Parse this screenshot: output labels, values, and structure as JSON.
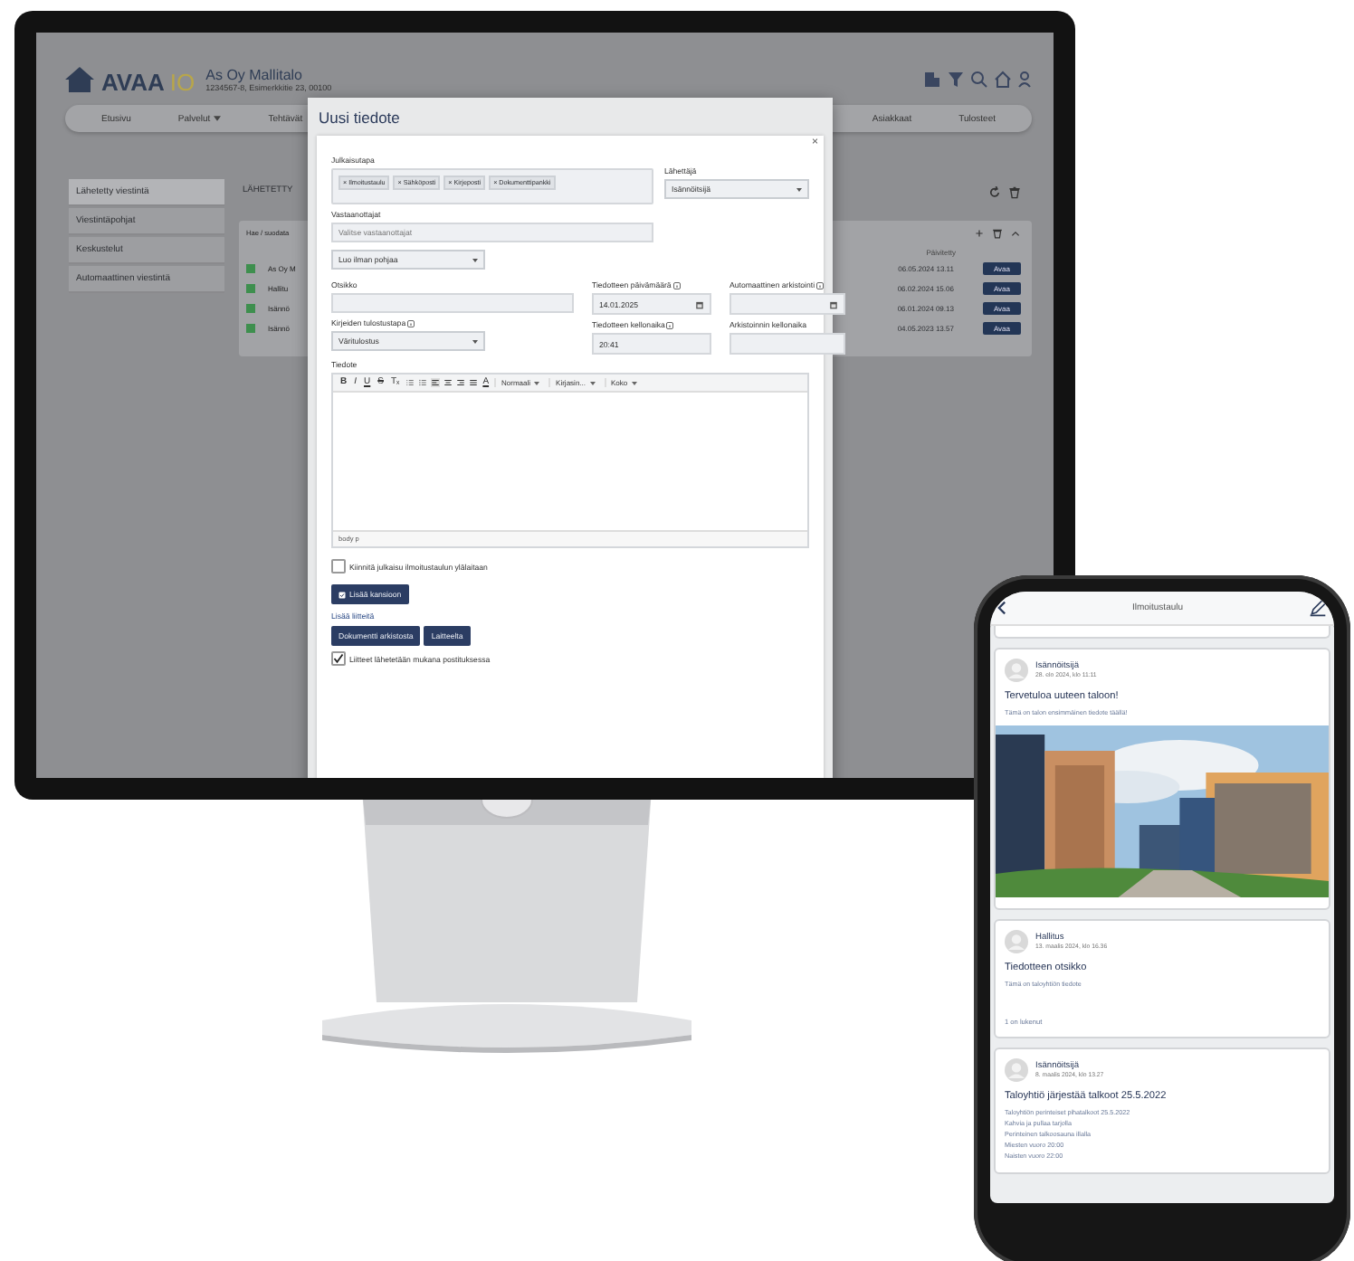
{
  "monitor": {
    "app": {
      "logo": {
        "text": "AVAA",
        "accent": "IO"
      },
      "company": "As Oy Mallitalo",
      "address": "1234567-8, Esimerkkitie 23, 00100",
      "nav": [
        {
          "label": "Etusivu",
          "dropdown": false
        },
        {
          "label": "Palvelut",
          "dropdown": true
        },
        {
          "label": "Tehtävät",
          "dropdown": false
        }
      ],
      "right_nav": [
        "Asiakkaat",
        "Tulosteet"
      ],
      "sidebar": [
        {
          "label": "Lähetetty viestintä",
          "selected": true
        },
        {
          "label": "Viestintäpohjat",
          "selected": false
        },
        {
          "label": "Keskustelut",
          "selected": false
        },
        {
          "label": "Automaattinen viestintä",
          "selected": false
        }
      ],
      "panel": {
        "title": "LÄHETETTY",
        "filter": "Hae / suodata",
        "column": "Päivitetty",
        "rows": [
          {
            "name": "As Oy M",
            "date": "06.05.2024 13.11",
            "action": "Avaa"
          },
          {
            "name": "Hallitu",
            "date": "06.02.2024 15.06",
            "action": "Avaa"
          },
          {
            "name": "Isännö",
            "date": "06.01.2024 09.13",
            "action": "Avaa"
          },
          {
            "name": "Isännö",
            "date": "04.05.2023 13.57",
            "action": "Avaa"
          }
        ]
      }
    },
    "modal": {
      "title": "Uusi tiedote",
      "close": "×",
      "publish": {
        "label": "Julkaisutapa",
        "chips": [
          "× Ilmoitustaulu",
          "× Sähköposti",
          "× Kirjeposti",
          "× Dokumenttipankki"
        ]
      },
      "sender": {
        "label": "Lähettäjä",
        "value": "Isännöitsijä"
      },
      "recipients": {
        "label": "Vastaanottajat",
        "placeholder": "Valitse vastaanottajat"
      },
      "template": {
        "value": "Luo ilman pohjaa"
      },
      "subject": {
        "label": "Otsikko"
      },
      "print_mode": {
        "label": "Kirjeiden tulostustapa",
        "info": true,
        "value": "Väritulostus"
      },
      "date": {
        "label": "Tiedotteen päivämäärä",
        "info": true,
        "value": "14.01.2025"
      },
      "time": {
        "label": "Tiedotteen kellonaika",
        "info": true,
        "value": "20:41"
      },
      "archive_date": {
        "label": "Automaattinen arkistointi",
        "info": true
      },
      "archive_time": {
        "label": "Arkistoinnin kellonaika",
        "info": false
      },
      "editor": {
        "label": "Tiedote",
        "format": [
          "B",
          "I",
          "U",
          "S",
          "Tₓ"
        ],
        "color_button": "A",
        "dropdowns": [
          "Normaali",
          "Kirjasin...",
          "Koko"
        ],
        "path": "body  p"
      },
      "pin": {
        "label": "Kiinnitä julkaisu ilmoitustaulun ylälaitaan",
        "checked": false
      },
      "folder_button": "Lisää kansioon",
      "attachments_link": "Lisää liitteitä",
      "attachment_buttons": [
        "Dokumentti arkistosta",
        "Laitteelta"
      ],
      "mail_attachments": {
        "label": "Liitteet lähetetään mukana postituksessa",
        "checked": true
      }
    }
  },
  "phone": {
    "title": "Ilmoitustaulu",
    "posts": [
      {
        "author": "Isännöitsijä",
        "date": "28. elo 2024, klo 11:11",
        "title": "Tervetuloa uuteen taloon!",
        "lines": [
          "Tämä on talon ensimmäinen tiedote täällä!"
        ],
        "kind": "picture"
      },
      {
        "author": "Hallitus",
        "date": "13. maalis 2024, klo 16.36",
        "title": "Tiedotteen otsikko",
        "lines": [
          "Tämä on taloyhtiön tiedote"
        ],
        "reads": "1 on lukenut",
        "kind": "text"
      },
      {
        "author": "Isännöitsijä",
        "date": "8. maalis 2024, klo 13.27",
        "title": "Taloyhtiö järjestää talkoot 25.5.2022",
        "lines": [
          "Taloyhtiön perinteiset pihatalkoot 25.5.2022",
          "Kahvia ja pullaa tarjolla",
          "Perinteinen talkoosauna illalla",
          "Miesten vuoro 20:00",
          "Naisten vuoro 22:00"
        ],
        "kind": "text"
      }
    ]
  }
}
